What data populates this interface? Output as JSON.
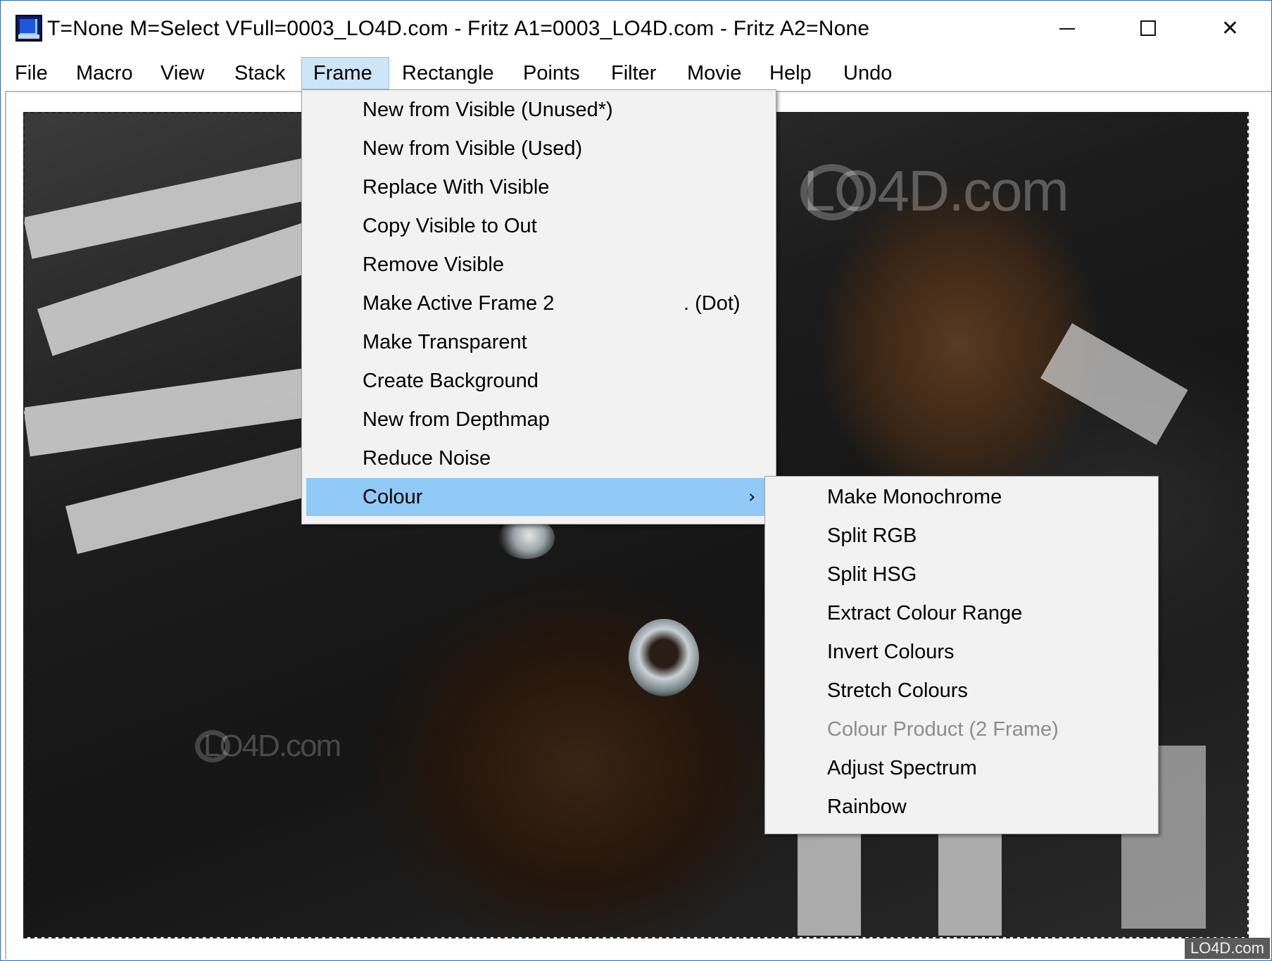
{
  "window": {
    "title": "T=None M=Select VFull=0003_LO4D.com - Fritz A1=0003_LO4D.com - Fritz A2=None",
    "minimize_icon": "minimize-icon",
    "maximize_icon": "maximize-icon",
    "close_icon": "close-icon",
    "close_glyph": "✕"
  },
  "menubar": {
    "items": [
      {
        "label": "File"
      },
      {
        "label": "Macro"
      },
      {
        "label": "View"
      },
      {
        "label": "Stack"
      },
      {
        "label": "Frame"
      },
      {
        "label": "Rectangle"
      },
      {
        "label": "Points"
      },
      {
        "label": "Filter"
      },
      {
        "label": "Movie"
      },
      {
        "label": "Help"
      },
      {
        "label": "Undo"
      }
    ],
    "active": "Frame"
  },
  "frame_menu": {
    "items": [
      {
        "label": "New from Visible (Unused*)"
      },
      {
        "label": "New from Visible (Used)"
      },
      {
        "label": "Replace With Visible"
      },
      {
        "label": "Copy Visible to Out"
      },
      {
        "label": "Remove Visible"
      },
      {
        "label": "Make Active Frame 2",
        "shortcut": ". (Dot)"
      },
      {
        "label": "Make Transparent"
      },
      {
        "label": "Create Background"
      },
      {
        "label": "New from Depthmap"
      },
      {
        "label": "Reduce Noise"
      },
      {
        "label": "Colour",
        "submenu_arrow": "›"
      }
    ],
    "highlighted": "Colour"
  },
  "colour_menu": {
    "items": [
      {
        "label": "Make Monochrome"
      },
      {
        "label": "Split RGB"
      },
      {
        "label": "Split HSG"
      },
      {
        "label": "Extract Colour Range"
      },
      {
        "label": "Invert Colours"
      },
      {
        "label": "Stretch Colours"
      },
      {
        "label": "Colour Product (2 Frame)",
        "disabled": true
      },
      {
        "label": "Adjust Spectrum"
      },
      {
        "label": "Rainbow"
      }
    ]
  },
  "canvas": {
    "watermark_large": "LO4D.com",
    "watermark_small": "LO4D.com",
    "corner_badge": "LO4D.com"
  },
  "colors": {
    "menu_highlight": "#91c9f7",
    "menubar_active": "#cde5f7",
    "menu_background": "#f2f2f2",
    "disabled_text": "#8d8d8d"
  }
}
